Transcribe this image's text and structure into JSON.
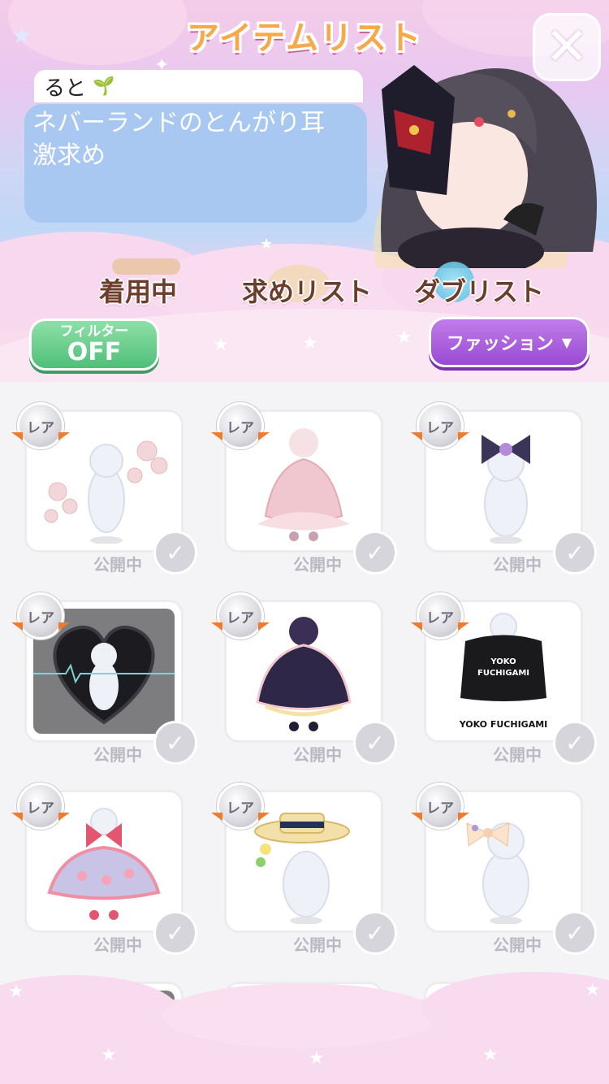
{
  "header": {
    "title": "アイテムリスト",
    "close_label": "✕"
  },
  "user": {
    "name": "ると",
    "comment": "ネバーランドのとんがり耳\n激求め"
  },
  "tabs": [
    "着用中",
    "求めリスト",
    "ダブリスト"
  ],
  "filter": {
    "line1": "フィルター",
    "line2": "OFF"
  },
  "category": {
    "label": "ファッション",
    "arrow": "▼"
  },
  "item_badge": "レア",
  "item_status": "公開中",
  "items": [
    {
      "badge": "レア",
      "status": "公開中",
      "art": "flower-accessory"
    },
    {
      "badge": "レア",
      "status": "公開中",
      "art": "pink-lolita-dress"
    },
    {
      "badge": "レア",
      "status": "公開中",
      "art": "ribbon-bow"
    },
    {
      "badge": "レア",
      "status": "公開中",
      "art": "black-heart-background"
    },
    {
      "badge": "レア",
      "status": "公開中",
      "art": "navy-frill-dress"
    },
    {
      "badge": "レア",
      "status": "公開中",
      "art": "black-hoodie",
      "caption": "YOKO FUCHIGAMI",
      "print": "YOKO\nFUCHIGAMI"
    },
    {
      "badge": "レア",
      "status": "公開中",
      "art": "heart-skirt-outfit"
    },
    {
      "badge": "レア",
      "status": "公開中",
      "art": "straw-boater-hat"
    },
    {
      "badge": "レア",
      "status": "公開中",
      "art": "peach-hair-bow"
    }
  ],
  "colors": {
    "rare_ribbon": "#f07b2c",
    "filter_green": "#4fbf79",
    "category_purple": "#9a4ad3",
    "comment_blue": "#a9c8f1"
  }
}
